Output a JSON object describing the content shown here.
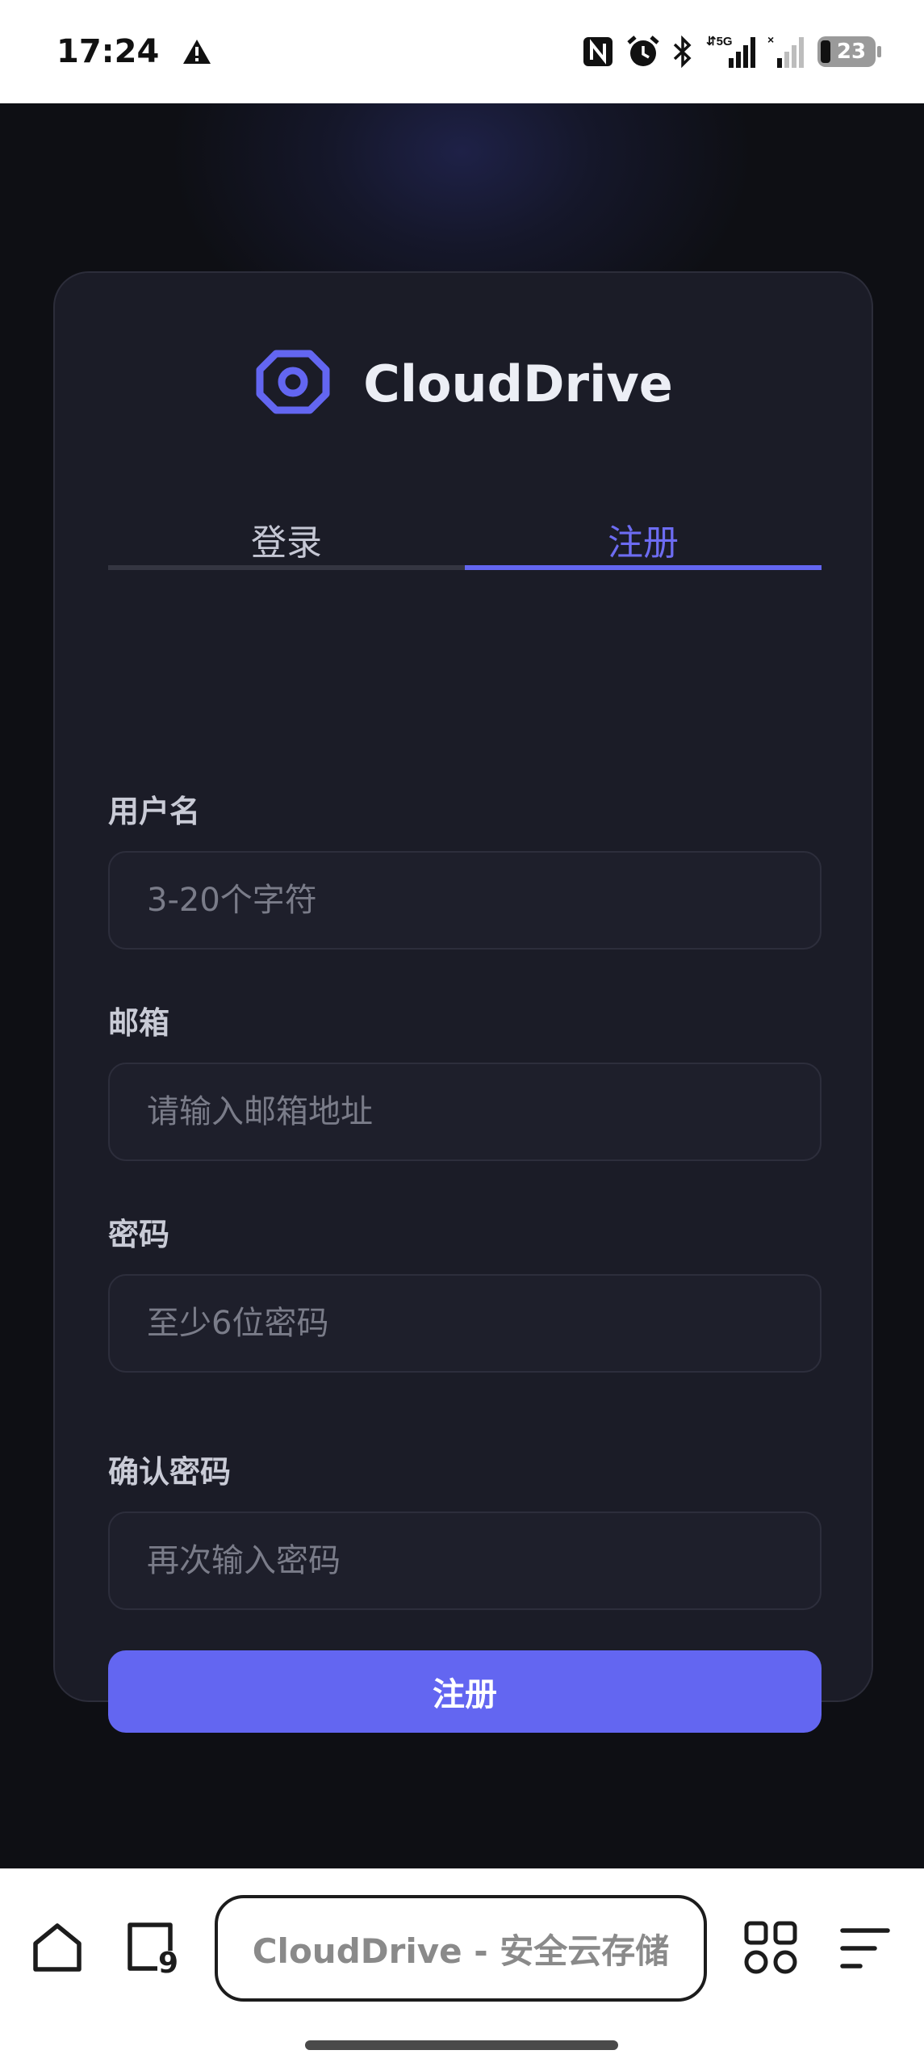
{
  "status_bar": {
    "time": "17:24",
    "network": "5G",
    "battery": "23"
  },
  "app": {
    "name": "CloudDrive",
    "accent_color": "#6366f1",
    "tabs": [
      {
        "label": "登录",
        "active": false
      },
      {
        "label": "注册",
        "active": true
      }
    ],
    "form": {
      "username": {
        "label": "用户名",
        "placeholder": "3-20个字符",
        "value": ""
      },
      "email": {
        "label": "邮箱",
        "placeholder": "请输入邮箱地址",
        "value": ""
      },
      "password": {
        "label": "密码",
        "placeholder": "至少6位密码",
        "value": ""
      },
      "confirm_password": {
        "label": "确认密码",
        "placeholder": "再次输入密码",
        "value": ""
      },
      "submit_label": "注册"
    }
  },
  "browser": {
    "page_title": "CloudDrive - 安全云存储",
    "tab_count": "9"
  }
}
